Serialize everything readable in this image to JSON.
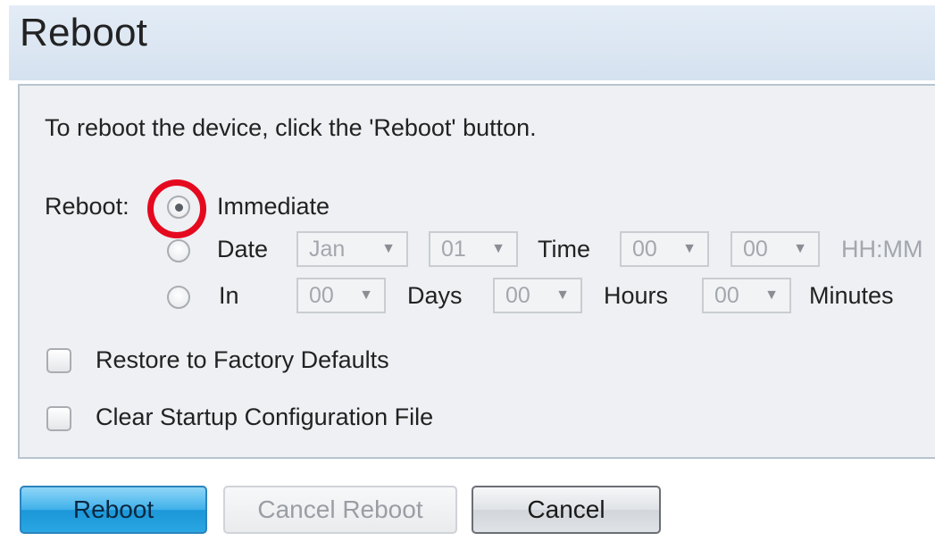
{
  "page": {
    "title": "Reboot"
  },
  "panel": {
    "instructions": "To reboot the device, click the 'Reboot' button.",
    "reboot_label": "Reboot:",
    "options": {
      "immediate": {
        "label": "Immediate",
        "selected": true
      },
      "date": {
        "label": "Date",
        "month": "Jan",
        "day": "01",
        "time_label": "Time",
        "hour": "00",
        "minute": "00",
        "format_hint": "HH:MM"
      },
      "in": {
        "label": "In",
        "days_value": "00",
        "days_label": "Days",
        "hours_value": "00",
        "hours_label": "Hours",
        "minutes_value": "00",
        "minutes_label": "Minutes"
      }
    },
    "restore_factory_label": "Restore to Factory Defaults",
    "clear_startup_label": "Clear Startup Configuration File"
  },
  "buttons": {
    "reboot": "Reboot",
    "cancel_reboot": "Cancel Reboot",
    "cancel": "Cancel"
  },
  "colors": {
    "highlight_ring": "#e5091f",
    "primary_button": "#2aa6e3"
  }
}
